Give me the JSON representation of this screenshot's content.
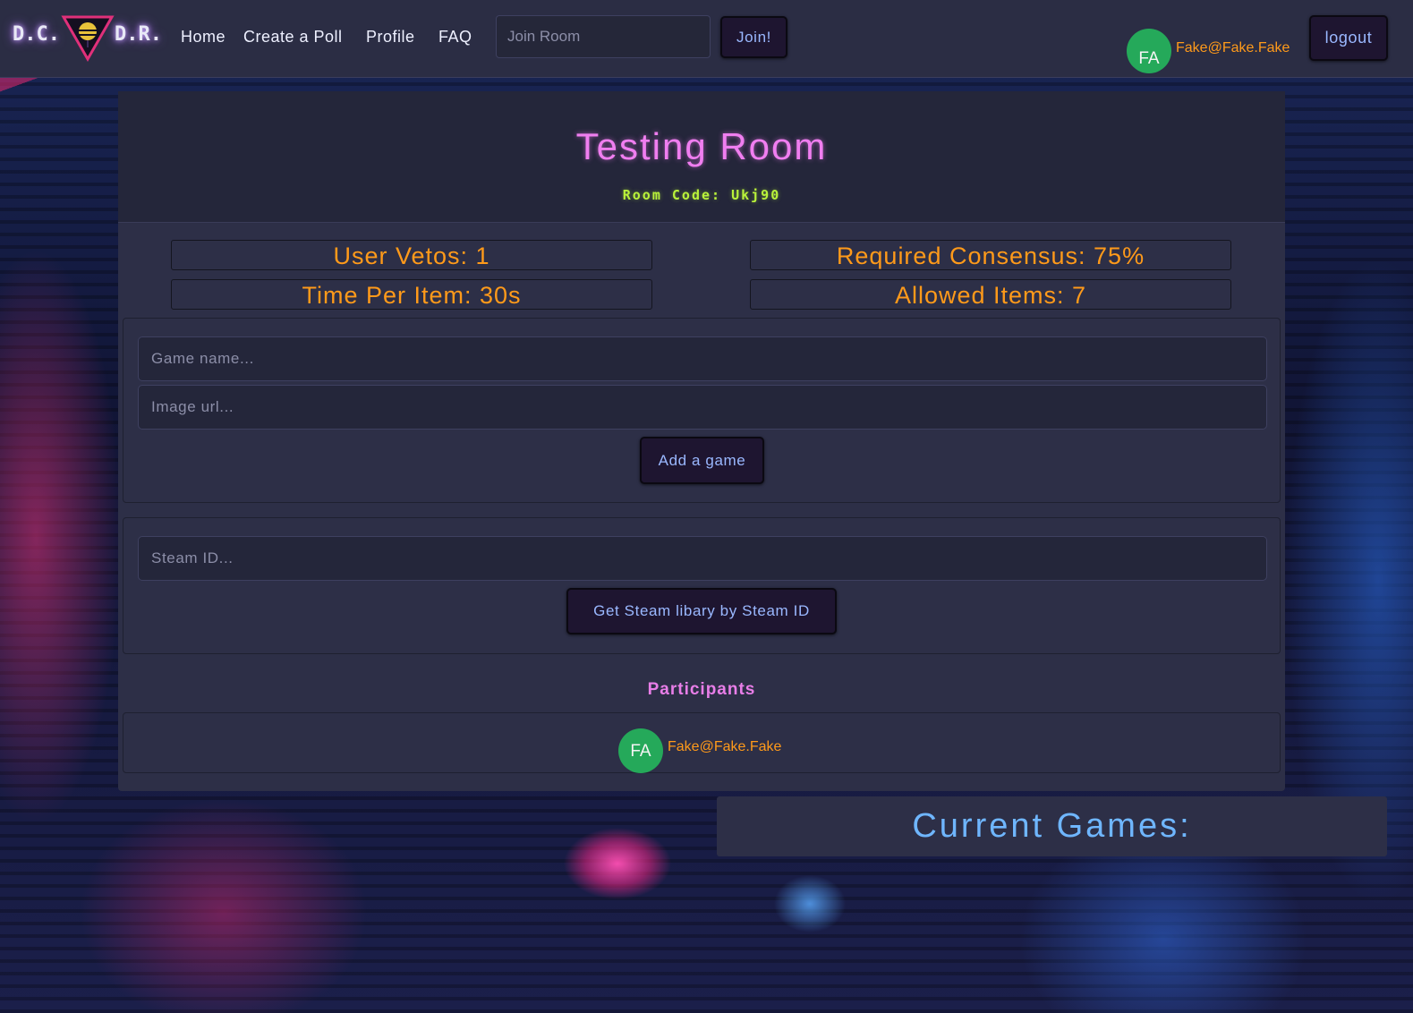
{
  "nav": {
    "brand_left": "D.C.",
    "brand_right": "D.R.",
    "links": [
      "Home",
      "Create a Poll",
      "Profile",
      "FAQ"
    ],
    "join_placeholder": "Join Room",
    "join_button": "Join!",
    "user_initials": "FA",
    "user_email": "Fake@Fake.Fake",
    "logout_button": "logout"
  },
  "room": {
    "title": "Testing Room",
    "code_label": "Room Code: Ukj90",
    "stats": {
      "user_vetos": "User Vetos: 1",
      "required_consensus": "Required Consensus: 75%",
      "time_per_item": "Time Per Item: 30s",
      "allowed_items": "Allowed Items: 7"
    },
    "add_game": {
      "name_placeholder": "Game name...",
      "image_placeholder": "Image url...",
      "button": "Add a game"
    },
    "steam": {
      "id_placeholder": "Steam ID...",
      "button": "Get Steam libary by Steam ID"
    },
    "participants": {
      "title": "Participants",
      "items": [
        {
          "initials": "FA",
          "email": "Fake@Fake.Fake"
        }
      ]
    }
  },
  "current_games": {
    "title": "Current Games:"
  },
  "colors": {
    "accent_orange": "#ff9a1a",
    "title_pink": "#f07ef0",
    "code_green": "#b9f23a",
    "avatar_green": "#25a95a",
    "games_blue": "#6fb6ff"
  }
}
